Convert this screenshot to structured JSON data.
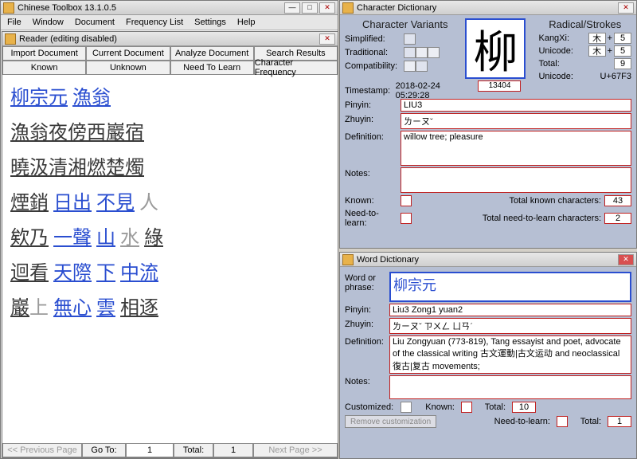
{
  "main": {
    "title": "Chinese Toolbox 13.1.0.5",
    "menu": [
      "File",
      "Window",
      "Document",
      "Frequency List",
      "Settings",
      "Help"
    ]
  },
  "reader": {
    "title": "Reader (editing disabled)",
    "buttons_row1": [
      "Import Document",
      "Current Document",
      "Analyze Document",
      "Search Results"
    ],
    "buttons_row2": [
      "Known",
      "Unknown",
      "Need To Learn",
      "Character Frequency"
    ],
    "lines": [
      [
        {
          "t": "柳宗元",
          "c": "blue u"
        },
        {
          "t": " ",
          "c": ""
        },
        {
          "t": "漁翁",
          "c": "blue u"
        }
      ],
      [
        {
          "t": "漁翁夜傍西巖宿",
          "c": "u"
        }
      ],
      [
        {
          "t": "曉汲清湘燃楚燭",
          "c": "u"
        }
      ],
      [
        {
          "t": "煙銷",
          "c": "u"
        },
        {
          "t": " ",
          "c": ""
        },
        {
          "t": "日出",
          "c": "blue u"
        },
        {
          "t": " ",
          "c": ""
        },
        {
          "t": "不見",
          "c": "blue u"
        },
        {
          "t": " ",
          "c": ""
        },
        {
          "t": "人",
          "c": "gray"
        }
      ],
      [
        {
          "t": "欸乃",
          "c": "u"
        },
        {
          "t": " ",
          "c": ""
        },
        {
          "t": "一聲",
          "c": "blue u"
        },
        {
          "t": " ",
          "c": ""
        },
        {
          "t": "山",
          "c": "blue u"
        },
        {
          "t": " ",
          "c": ""
        },
        {
          "t": "水",
          "c": "gray u"
        },
        {
          "t": " ",
          "c": ""
        },
        {
          "t": "綠",
          "c": "u"
        }
      ],
      [
        {
          "t": "迴看",
          "c": "u"
        },
        {
          "t": " ",
          "c": ""
        },
        {
          "t": "天際",
          "c": "blue u"
        },
        {
          "t": " ",
          "c": ""
        },
        {
          "t": "下",
          "c": "blue u"
        },
        {
          "t": " ",
          "c": ""
        },
        {
          "t": "中流",
          "c": "blue u"
        }
      ],
      [
        {
          "t": "巖",
          "c": "u"
        },
        {
          "t": "上",
          "c": "gray"
        },
        {
          "t": " ",
          "c": ""
        },
        {
          "t": "無心",
          "c": "blue u"
        },
        {
          "t": " ",
          "c": ""
        },
        {
          "t": "雲",
          "c": "blue u"
        },
        {
          "t": " ",
          "c": ""
        },
        {
          "t": "相逐",
          "c": "u"
        }
      ]
    ],
    "pager": {
      "prev": "<< Previous Page",
      "goto": "Go To:",
      "page": "1",
      "total_label": "Total:",
      "total": "1",
      "next": "Next Page >>"
    }
  },
  "chardict": {
    "title": "Character Dictionary",
    "heading_left": "Character Variants",
    "heading_right": "Radical/Strokes",
    "labels": {
      "simplified": "Simplified:",
      "traditional": "Traditional:",
      "compatibility": "Compatibility:",
      "timestamp": "Timestamp:"
    },
    "timestamp": "2018-02-24 05:29:28",
    "big_char": "柳",
    "char_id": "13404",
    "rad": {
      "kangxi_l": "KangXi:",
      "kangxi_r": "木",
      "kangxi_p": "+",
      "kangxi_n": "5",
      "unicode_l": "Unicode:",
      "unicode_r": "木",
      "unicode_p": "+",
      "unicode_n": "5",
      "total_l": "Total:",
      "total_n": "9",
      "ucode_l": "Unicode:",
      "ucode_v": "U+67F3"
    },
    "pinyin_l": "Pinyin:",
    "pinyin_v": "LIU3",
    "zhuyin_l": "Zhuyin:",
    "zhuyin_v": "ㄌㄧㄡˇ",
    "def_l": "Definition:",
    "def_v": "willow tree; pleasure",
    "notes_l": "Notes:",
    "known_l": "Known:",
    "tk_char": "Total known characters:",
    "tk_val": "43",
    "ntl_l": "Need-to-learn:",
    "tn_char": "Total need-to-learn characters:",
    "tn_val": "2"
  },
  "worddict": {
    "title": "Word Dictionary",
    "word_l": "Word or phrase:",
    "word_v": "柳宗元",
    "pinyin_l": "Pinyin:",
    "pinyin_v": "Liu3 Zong1 yuan2",
    "zhuyin_l": "Zhuyin:",
    "zhuyin_v": "ㄌㄧㄡˇ ㄗㄨㄥ ㄩㄢˊ",
    "def_l": "Definition:",
    "def_v": "Liu Zongyuan (773-819),  Tang essayist and poet,  advocate of the classical writing 古文運動|古文运动 and neoclassical 復古|复古 movements;",
    "notes_l": "Notes:",
    "customized_l": "Customized:",
    "known_l": "Known:",
    "needtolearn_l": "Need-to-learn:",
    "total1_l": "Total:",
    "total1_v": "10",
    "total2_l": "Total:",
    "total2_v": "1",
    "remove_btn": "Remove customization"
  }
}
